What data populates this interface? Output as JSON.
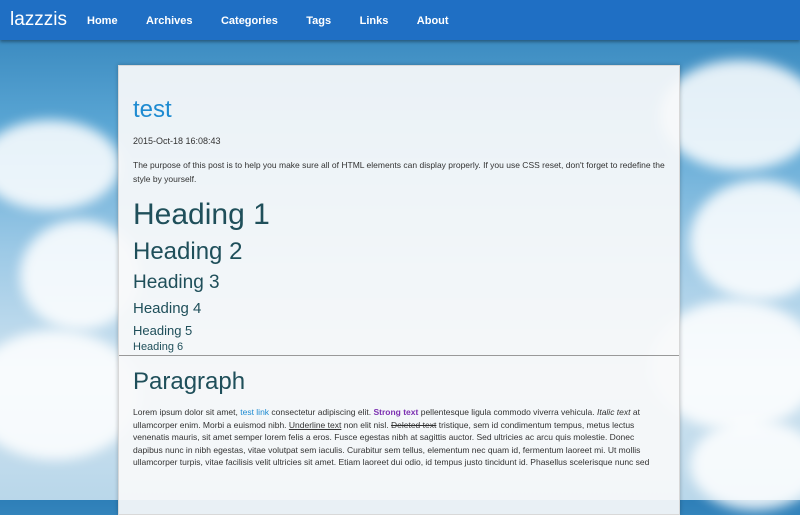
{
  "brand": "lazzzis",
  "nav": [
    "Home",
    "Archives",
    "Categories",
    "Tags",
    "Links",
    "About"
  ],
  "post": {
    "title": "test",
    "date": "2015-Oct-18 16:08:43",
    "intro": "The purpose of this post is to help you make sure all of HTML elements can display properly. If you use CSS reset, don't forget to redefine the style by yourself.",
    "headings": [
      "Heading 1",
      "Heading 2",
      "Heading 3",
      "Heading 4",
      "Heading 5",
      "Heading 6"
    ],
    "paragraph_title": "Paragraph",
    "paragraph": {
      "p1": "Lorem ipsum dolor sit amet, ",
      "link": "test link",
      "p2": " consectetur adipiscing elit. ",
      "strong": "Strong text",
      "p3": " pellentesque ligula commodo viverra vehicula. ",
      "italic": "Italic text",
      "p4": " at ullamcorper enim. Morbi a euismod nibh. ",
      "underline": "Underline text",
      "p5": " non elit nisl. ",
      "deleted": "Deleted text",
      "p6": " tristique, sem id condimentum tempus, metus lectus venenatis mauris, sit amet semper lorem felis a eros. Fusce egestas nibh at sagittis auctor. Sed ultricies ac arcu quis molestie. Donec dapibus nunc in nibh egestas, vitae volutpat sem iaculis. Curabitur sem tellus, elementum nec quam id, fermentum laoreet mi. Ut mollis ullamcorper turpis, vitae facilisis velit ultricies sit amet. Etiam laoreet dui odio, id tempus justo tincidunt id. Phasellus scelerisque nunc sed"
    }
  },
  "colors": {
    "topbar": "#1f6fc4",
    "link": "#1e8bd1",
    "strong": "#7b2fb0",
    "heading": "#1f4f5a"
  }
}
